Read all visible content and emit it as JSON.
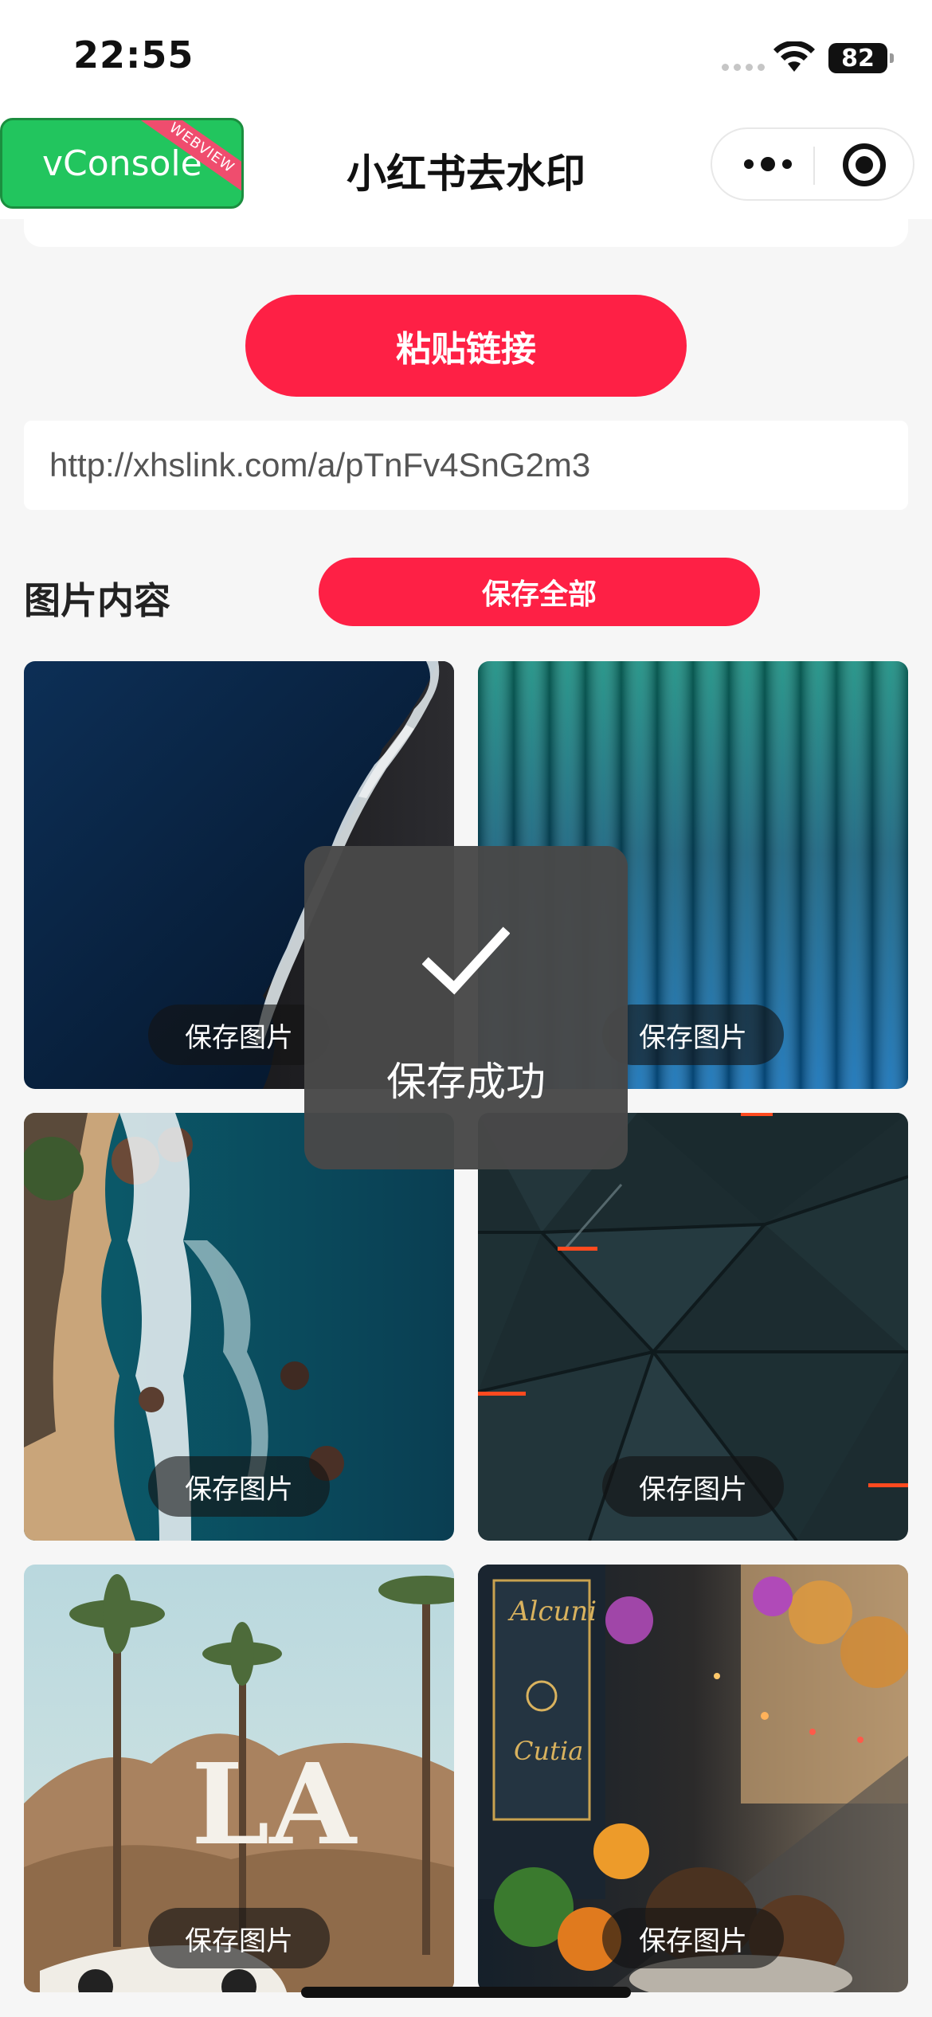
{
  "status_bar": {
    "time": "22:55",
    "battery": "82"
  },
  "nav": {
    "title": "小红书去水印"
  },
  "vconsole": {
    "label": "vConsole",
    "ribbon": "WEBVIEW"
  },
  "paste_button": "粘贴链接",
  "url_input": {
    "value": "http://xhslink.com/a/pTnFv4SnG2m3"
  },
  "images_section": {
    "title": "图片内容",
    "save_all": "保存全部"
  },
  "images": [
    {
      "save_label": "保存图片"
    },
    {
      "save_label": "保存图片"
    },
    {
      "save_label": "保存图片"
    },
    {
      "save_label": "保存图片"
    },
    {
      "save_label": "保存图片"
    },
    {
      "save_label": "保存图片"
    }
  ],
  "image_text": {
    "la_logo": "LA",
    "cafe_sign_1": "Alcuni",
    "cafe_sign_2": "Cutia"
  },
  "toast": {
    "message": "保存成功"
  },
  "colors": {
    "accent": "#fe2045",
    "vconsole": "#22c55e",
    "toast_bg": "#484848"
  },
  "icons": [
    "wifi-icon",
    "battery-icon",
    "more-icon",
    "close-icon",
    "check-icon"
  ]
}
